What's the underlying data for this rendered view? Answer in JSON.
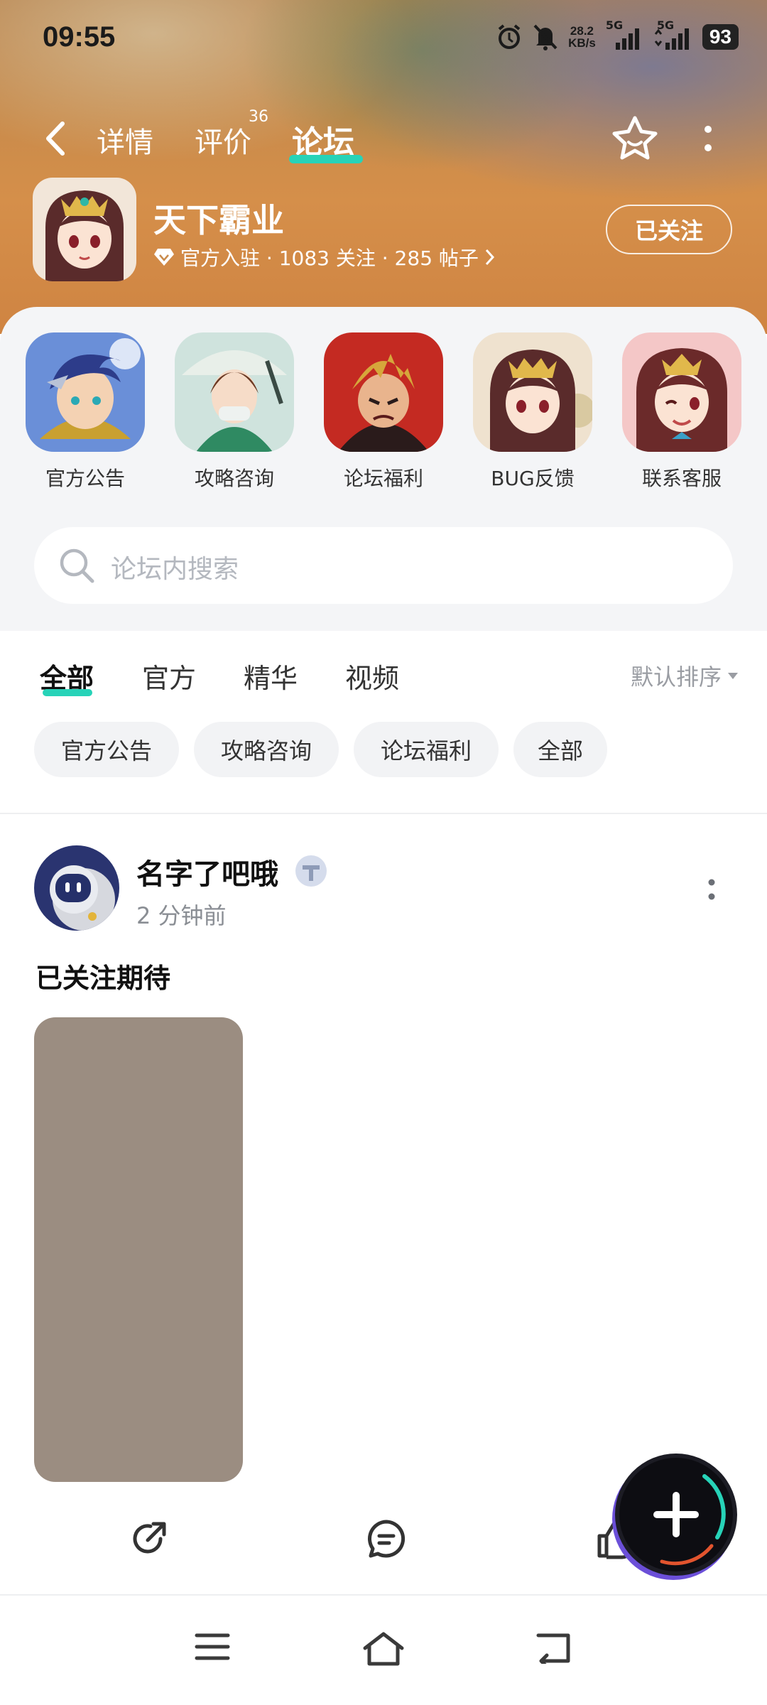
{
  "status_bar": {
    "time": "09:55",
    "net_speed_value": "28.2",
    "net_speed_unit": "KB/s",
    "signal_1": "5G",
    "signal_2": "5G",
    "battery": "93"
  },
  "nav": {
    "tabs": [
      {
        "label": "详情"
      },
      {
        "label": "评价",
        "badge": "36"
      },
      {
        "label": "论坛"
      }
    ],
    "active_tab": "论坛"
  },
  "game": {
    "name": "天下霸业",
    "meta": "官方入驻 · 1083 关注 · 285 帖子",
    "follow_label": "已关注"
  },
  "categories": [
    {
      "label": "官方公告"
    },
    {
      "label": "攻略咨询"
    },
    {
      "label": "论坛福利"
    },
    {
      "label": "BUG反馈"
    },
    {
      "label": "联系客服"
    }
  ],
  "search": {
    "placeholder": "论坛内搜索"
  },
  "filter_tabs": [
    {
      "label": "全部"
    },
    {
      "label": "官方"
    },
    {
      "label": "精华"
    },
    {
      "label": "视频"
    }
  ],
  "sort_label": "默认排序",
  "chips": [
    {
      "label": "官方公告"
    },
    {
      "label": "攻略咨询"
    },
    {
      "label": "论坛福利"
    },
    {
      "label": "全部"
    }
  ],
  "post": {
    "author": "名字了吧哦",
    "time": "2 分钟前",
    "text": "已关注期待"
  },
  "colors": {
    "accent": "#27d3b8",
    "header_bg": "#c98b4b",
    "panel_bg": "#f4f5f7",
    "image_placeholder": "#9b8d81"
  },
  "icons": [
    "back-icon",
    "star-face-icon",
    "more-vertical-icon",
    "diamond-icon",
    "chevron-right-icon",
    "search-icon",
    "sort-caret-icon",
    "share-icon",
    "comment-icon",
    "like-icon",
    "plus-icon",
    "menu-icon",
    "home-icon",
    "back-nav-icon"
  ]
}
